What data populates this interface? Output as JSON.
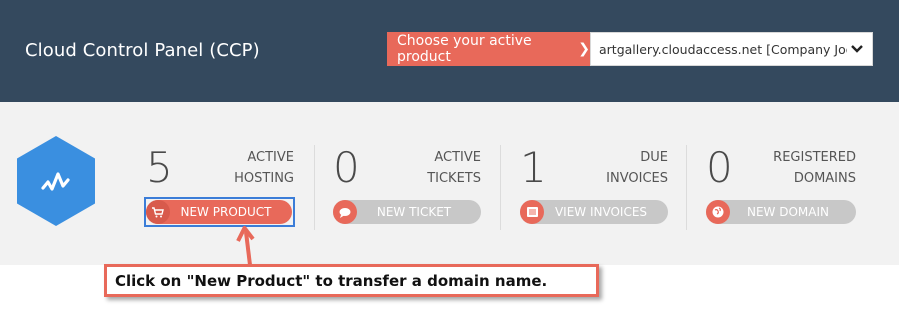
{
  "header": {
    "title": "Cloud Control Panel (CCP)",
    "choose_label": "Choose your active product",
    "choose_icon": "chevron-right-icon",
    "product_value": "artgallery.cloudaccess.net [Company Joo...",
    "select_icon": "chevron-down-icon"
  },
  "stats": [
    {
      "count": "5",
      "label_line1": "ACTIVE",
      "label_line2": "HOSTING",
      "button": "NEW PRODUCT",
      "icon": "cart-icon"
    },
    {
      "count": "0",
      "label_line1": "ACTIVE",
      "label_line2": "TICKETS",
      "button": "NEW TICKET",
      "icon": "chat-bubble-icon"
    },
    {
      "count": "1",
      "label_line1": "DUE",
      "label_line2": "INVOICES",
      "button": "VIEW INVOICES",
      "icon": "invoice-list-icon"
    },
    {
      "count": "0",
      "label_line1": "REGISTERED",
      "label_line2": "DOMAINS",
      "button": "NEW DOMAIN",
      "icon": "globe-icon"
    }
  ],
  "callout": {
    "text": "Click on \"New Product\" to transfer a domain name."
  },
  "colors": {
    "header_bg": "#34495e",
    "accent": "#e8695a",
    "hex_logo": "#3a8fe0",
    "highlight": "#3b7dd8"
  }
}
